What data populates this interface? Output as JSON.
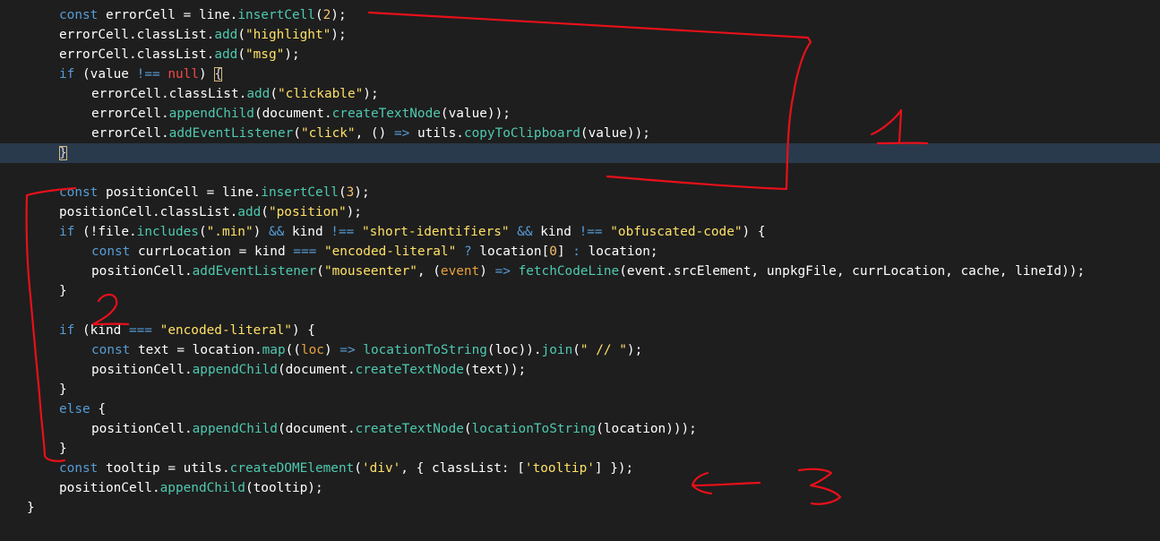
{
  "editor": {
    "background": "#1e1e1e",
    "current_line_background": "#2a3a4d",
    "current_line_index": 7,
    "lines": [
      {
        "indent": 1,
        "tokens": [
          {
            "t": "const",
            "k": "keyword"
          },
          {
            "t": " ",
            "k": "plain"
          },
          {
            "t": "errorCell",
            "k": "variable"
          },
          {
            "t": " = ",
            "k": "plain"
          },
          {
            "t": "line",
            "k": "variable"
          },
          {
            "t": ".",
            "k": "plain"
          },
          {
            "t": "insertCell",
            "k": "method"
          },
          {
            "t": "(",
            "k": "plain"
          },
          {
            "t": "2",
            "k": "number"
          },
          {
            "t": ");",
            "k": "plain"
          }
        ]
      },
      {
        "indent": 1,
        "tokens": [
          {
            "t": "errorCell",
            "k": "variable"
          },
          {
            "t": ".",
            "k": "plain"
          },
          {
            "t": "classList",
            "k": "variable"
          },
          {
            "t": ".",
            "k": "plain"
          },
          {
            "t": "add",
            "k": "method"
          },
          {
            "t": "(",
            "k": "plain"
          },
          {
            "t": "\"highlight\"",
            "k": "string"
          },
          {
            "t": ");",
            "k": "plain"
          }
        ]
      },
      {
        "indent": 1,
        "tokens": [
          {
            "t": "errorCell",
            "k": "variable"
          },
          {
            "t": ".",
            "k": "plain"
          },
          {
            "t": "classList",
            "k": "variable"
          },
          {
            "t": ".",
            "k": "plain"
          },
          {
            "t": "add",
            "k": "method"
          },
          {
            "t": "(",
            "k": "plain"
          },
          {
            "t": "\"msg\"",
            "k": "string"
          },
          {
            "t": ");",
            "k": "plain"
          }
        ]
      },
      {
        "indent": 1,
        "tokens": [
          {
            "t": "if",
            "k": "control"
          },
          {
            "t": " (",
            "k": "plain"
          },
          {
            "t": "value",
            "k": "variable"
          },
          {
            "t": " ",
            "k": "plain"
          },
          {
            "t": "!==",
            "k": "operator"
          },
          {
            "t": " ",
            "k": "plain"
          },
          {
            "t": "null",
            "k": "null"
          },
          {
            "t": ") ",
            "k": "plain"
          },
          {
            "t": "{",
            "k": "bracket-match"
          }
        ]
      },
      {
        "indent": 2,
        "tokens": [
          {
            "t": "errorCell",
            "k": "variable"
          },
          {
            "t": ".",
            "k": "plain"
          },
          {
            "t": "classList",
            "k": "variable"
          },
          {
            "t": ".",
            "k": "plain"
          },
          {
            "t": "add",
            "k": "method"
          },
          {
            "t": "(",
            "k": "plain"
          },
          {
            "t": "\"clickable\"",
            "k": "string"
          },
          {
            "t": ");",
            "k": "plain"
          }
        ]
      },
      {
        "indent": 2,
        "tokens": [
          {
            "t": "errorCell",
            "k": "variable"
          },
          {
            "t": ".",
            "k": "plain"
          },
          {
            "t": "appendChild",
            "k": "method"
          },
          {
            "t": "(",
            "k": "plain"
          },
          {
            "t": "document",
            "k": "variable"
          },
          {
            "t": ".",
            "k": "plain"
          },
          {
            "t": "createTextNode",
            "k": "method"
          },
          {
            "t": "(",
            "k": "plain"
          },
          {
            "t": "value",
            "k": "variable"
          },
          {
            "t": "));",
            "k": "plain"
          }
        ]
      },
      {
        "indent": 2,
        "tokens": [
          {
            "t": "errorCell",
            "k": "variable"
          },
          {
            "t": ".",
            "k": "plain"
          },
          {
            "t": "addEventListener",
            "k": "method"
          },
          {
            "t": "(",
            "k": "plain"
          },
          {
            "t": "\"click\"",
            "k": "string"
          },
          {
            "t": ", () ",
            "k": "plain"
          },
          {
            "t": "=>",
            "k": "operator"
          },
          {
            "t": " ",
            "k": "plain"
          },
          {
            "t": "utils",
            "k": "variable"
          },
          {
            "t": ".",
            "k": "plain"
          },
          {
            "t": "copyToClipboard",
            "k": "method"
          },
          {
            "t": "(",
            "k": "plain"
          },
          {
            "t": "value",
            "k": "variable"
          },
          {
            "t": "));",
            "k": "plain"
          }
        ]
      },
      {
        "indent": 1,
        "tokens": [
          {
            "t": "}",
            "k": "bracket-match"
          }
        ]
      },
      {
        "indent": 0,
        "tokens": []
      },
      {
        "indent": 1,
        "tokens": [
          {
            "t": "const",
            "k": "keyword"
          },
          {
            "t": " ",
            "k": "plain"
          },
          {
            "t": "positionCell",
            "k": "variable"
          },
          {
            "t": " = ",
            "k": "plain"
          },
          {
            "t": "line",
            "k": "variable"
          },
          {
            "t": ".",
            "k": "plain"
          },
          {
            "t": "insertCell",
            "k": "method"
          },
          {
            "t": "(",
            "k": "plain"
          },
          {
            "t": "3",
            "k": "number"
          },
          {
            "t": ");",
            "k": "plain"
          }
        ]
      },
      {
        "indent": 1,
        "tokens": [
          {
            "t": "positionCell",
            "k": "variable"
          },
          {
            "t": ".",
            "k": "plain"
          },
          {
            "t": "classList",
            "k": "variable"
          },
          {
            "t": ".",
            "k": "plain"
          },
          {
            "t": "add",
            "k": "method"
          },
          {
            "t": "(",
            "k": "plain"
          },
          {
            "t": "\"position\"",
            "k": "string"
          },
          {
            "t": ");",
            "k": "plain"
          }
        ]
      },
      {
        "indent": 1,
        "tokens": [
          {
            "t": "if",
            "k": "control"
          },
          {
            "t": " (!",
            "k": "plain"
          },
          {
            "t": "file",
            "k": "variable"
          },
          {
            "t": ".",
            "k": "plain"
          },
          {
            "t": "includes",
            "k": "method"
          },
          {
            "t": "(",
            "k": "plain"
          },
          {
            "t": "\".min\"",
            "k": "string"
          },
          {
            "t": ") ",
            "k": "plain"
          },
          {
            "t": "&&",
            "k": "operator"
          },
          {
            "t": " ",
            "k": "plain"
          },
          {
            "t": "kind",
            "k": "variable"
          },
          {
            "t": " ",
            "k": "plain"
          },
          {
            "t": "!==",
            "k": "operator"
          },
          {
            "t": " ",
            "k": "plain"
          },
          {
            "t": "\"short-identifiers\"",
            "k": "string"
          },
          {
            "t": " ",
            "k": "plain"
          },
          {
            "t": "&&",
            "k": "operator"
          },
          {
            "t": " ",
            "k": "plain"
          },
          {
            "t": "kind",
            "k": "variable"
          },
          {
            "t": " ",
            "k": "plain"
          },
          {
            "t": "!==",
            "k": "operator"
          },
          {
            "t": " ",
            "k": "plain"
          },
          {
            "t": "\"obfuscated-code\"",
            "k": "string"
          },
          {
            "t": ") {",
            "k": "plain"
          }
        ]
      },
      {
        "indent": 2,
        "tokens": [
          {
            "t": "const",
            "k": "keyword"
          },
          {
            "t": " ",
            "k": "plain"
          },
          {
            "t": "currLocation",
            "k": "variable"
          },
          {
            "t": " = ",
            "k": "plain"
          },
          {
            "t": "kind",
            "k": "variable"
          },
          {
            "t": " ",
            "k": "plain"
          },
          {
            "t": "===",
            "k": "operator"
          },
          {
            "t": " ",
            "k": "plain"
          },
          {
            "t": "\"encoded-literal\"",
            "k": "string"
          },
          {
            "t": " ",
            "k": "plain"
          },
          {
            "t": "?",
            "k": "operator"
          },
          {
            "t": " ",
            "k": "plain"
          },
          {
            "t": "location",
            "k": "variable"
          },
          {
            "t": "[",
            "k": "plain"
          },
          {
            "t": "0",
            "k": "number"
          },
          {
            "t": "] ",
            "k": "plain"
          },
          {
            "t": ":",
            "k": "operator"
          },
          {
            "t": " ",
            "k": "plain"
          },
          {
            "t": "location",
            "k": "variable"
          },
          {
            "t": ";",
            "k": "plain"
          }
        ]
      },
      {
        "indent": 2,
        "tokens": [
          {
            "t": "positionCell",
            "k": "variable"
          },
          {
            "t": ".",
            "k": "plain"
          },
          {
            "t": "addEventListener",
            "k": "method"
          },
          {
            "t": "(",
            "k": "plain"
          },
          {
            "t": "\"mouseenter\"",
            "k": "string"
          },
          {
            "t": ", (",
            "k": "plain"
          },
          {
            "t": "event",
            "k": "param"
          },
          {
            "t": ") ",
            "k": "plain"
          },
          {
            "t": "=>",
            "k": "operator"
          },
          {
            "t": " ",
            "k": "plain"
          },
          {
            "t": "fetchCodeLine",
            "k": "method"
          },
          {
            "t": "(",
            "k": "plain"
          },
          {
            "t": "event",
            "k": "variable"
          },
          {
            "t": ".",
            "k": "plain"
          },
          {
            "t": "srcElement",
            "k": "variable"
          },
          {
            "t": ", ",
            "k": "plain"
          },
          {
            "t": "unpkgFile",
            "k": "variable"
          },
          {
            "t": ", ",
            "k": "plain"
          },
          {
            "t": "currLocation",
            "k": "variable"
          },
          {
            "t": ", ",
            "k": "plain"
          },
          {
            "t": "cache",
            "k": "variable"
          },
          {
            "t": ", ",
            "k": "plain"
          },
          {
            "t": "lineId",
            "k": "variable"
          },
          {
            "t": "));",
            "k": "plain"
          }
        ]
      },
      {
        "indent": 1,
        "tokens": [
          {
            "t": "}",
            "k": "plain"
          }
        ]
      },
      {
        "indent": 0,
        "tokens": []
      },
      {
        "indent": 1,
        "tokens": [
          {
            "t": "if",
            "k": "control"
          },
          {
            "t": " (",
            "k": "plain"
          },
          {
            "t": "kind",
            "k": "variable"
          },
          {
            "t": " ",
            "k": "plain"
          },
          {
            "t": "===",
            "k": "operator"
          },
          {
            "t": " ",
            "k": "plain"
          },
          {
            "t": "\"encoded-literal\"",
            "k": "string"
          },
          {
            "t": ") {",
            "k": "plain"
          }
        ]
      },
      {
        "indent": 2,
        "tokens": [
          {
            "t": "const",
            "k": "keyword"
          },
          {
            "t": " ",
            "k": "plain"
          },
          {
            "t": "text",
            "k": "variable"
          },
          {
            "t": " = ",
            "k": "plain"
          },
          {
            "t": "location",
            "k": "variable"
          },
          {
            "t": ".",
            "k": "plain"
          },
          {
            "t": "map",
            "k": "method"
          },
          {
            "t": "((",
            "k": "plain"
          },
          {
            "t": "loc",
            "k": "param"
          },
          {
            "t": ") ",
            "k": "plain"
          },
          {
            "t": "=>",
            "k": "operator"
          },
          {
            "t": " ",
            "k": "plain"
          },
          {
            "t": "locationToString",
            "k": "method"
          },
          {
            "t": "(",
            "k": "plain"
          },
          {
            "t": "loc",
            "k": "variable"
          },
          {
            "t": ")).",
            "k": "plain"
          },
          {
            "t": "join",
            "k": "method"
          },
          {
            "t": "(",
            "k": "plain"
          },
          {
            "t": "\" // \"",
            "k": "string"
          },
          {
            "t": ");",
            "k": "plain"
          }
        ]
      },
      {
        "indent": 2,
        "tokens": [
          {
            "t": "positionCell",
            "k": "variable"
          },
          {
            "t": ".",
            "k": "plain"
          },
          {
            "t": "appendChild",
            "k": "method"
          },
          {
            "t": "(",
            "k": "plain"
          },
          {
            "t": "document",
            "k": "variable"
          },
          {
            "t": ".",
            "k": "plain"
          },
          {
            "t": "createTextNode",
            "k": "method"
          },
          {
            "t": "(",
            "k": "plain"
          },
          {
            "t": "text",
            "k": "variable"
          },
          {
            "t": "));",
            "k": "plain"
          }
        ]
      },
      {
        "indent": 1,
        "tokens": [
          {
            "t": "}",
            "k": "plain"
          }
        ]
      },
      {
        "indent": 1,
        "tokens": [
          {
            "t": "else",
            "k": "control"
          },
          {
            "t": " {",
            "k": "plain"
          }
        ]
      },
      {
        "indent": 2,
        "tokens": [
          {
            "t": "positionCell",
            "k": "variable"
          },
          {
            "t": ".",
            "k": "plain"
          },
          {
            "t": "appendChild",
            "k": "method"
          },
          {
            "t": "(",
            "k": "plain"
          },
          {
            "t": "document",
            "k": "variable"
          },
          {
            "t": ".",
            "k": "plain"
          },
          {
            "t": "createTextNode",
            "k": "method"
          },
          {
            "t": "(",
            "k": "plain"
          },
          {
            "t": "locationToString",
            "k": "method"
          },
          {
            "t": "(",
            "k": "plain"
          },
          {
            "t": "location",
            "k": "variable"
          },
          {
            "t": ")));",
            "k": "plain"
          }
        ]
      },
      {
        "indent": 1,
        "tokens": [
          {
            "t": "}",
            "k": "plain"
          }
        ]
      },
      {
        "indent": 1,
        "tokens": [
          {
            "t": "const",
            "k": "keyword"
          },
          {
            "t": " ",
            "k": "plain"
          },
          {
            "t": "tooltip",
            "k": "variable"
          },
          {
            "t": " = ",
            "k": "plain"
          },
          {
            "t": "utils",
            "k": "variable"
          },
          {
            "t": ".",
            "k": "plain"
          },
          {
            "t": "createDOMElement",
            "k": "method"
          },
          {
            "t": "(",
            "k": "plain"
          },
          {
            "t": "'div'",
            "k": "string"
          },
          {
            "t": ", { ",
            "k": "plain"
          },
          {
            "t": "classList",
            "k": "variable"
          },
          {
            "t": ": [",
            "k": "plain"
          },
          {
            "t": "'tooltip'",
            "k": "string"
          },
          {
            "t": "] });",
            "k": "plain"
          }
        ]
      },
      {
        "indent": 1,
        "tokens": [
          {
            "t": "positionCell",
            "k": "variable"
          },
          {
            "t": ".",
            "k": "plain"
          },
          {
            "t": "appendChild",
            "k": "method"
          },
          {
            "t": "(",
            "k": "plain"
          },
          {
            "t": "tooltip",
            "k": "variable"
          },
          {
            "t": ");",
            "k": "plain"
          }
        ]
      },
      {
        "indent": 0,
        "tokens": [
          {
            "t": "}",
            "k": "plain"
          }
        ]
      }
    ]
  },
  "annotations": {
    "color": "#e8101a",
    "labels": [
      {
        "id": "1",
        "description": "bracket around errorCell block"
      },
      {
        "id": "2",
        "description": "bracket around positionCell block"
      },
      {
        "id": "3",
        "description": "arrow pointing at tooltip line"
      }
    ]
  }
}
